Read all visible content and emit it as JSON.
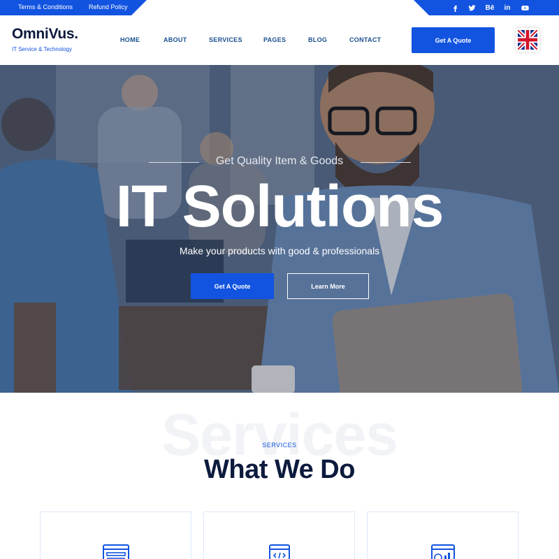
{
  "topbar": {
    "links": [
      "Terms & Conditions",
      "Refund Policy"
    ],
    "social": [
      {
        "icon": "facebook-icon",
        "glyph": "f"
      },
      {
        "icon": "twitter-icon",
        "glyph": "t"
      },
      {
        "icon": "behance-icon",
        "glyph": "Bē"
      },
      {
        "icon": "linkedin-icon",
        "glyph": "in"
      },
      {
        "icon": "youtube-icon",
        "glyph": "▶"
      }
    ]
  },
  "header": {
    "logo": "OmniVus.",
    "tagline": "IT Service & Technology",
    "nav": [
      "HOME",
      "ABOUT",
      "SERVICES",
      "PAGES",
      "BLOG",
      "CONTACT"
    ],
    "cta": "Get A Quote",
    "language_icon": "uk-flag-icon"
  },
  "hero": {
    "eyebrow": "Get Quality Item & Goods",
    "title": "IT Solutions",
    "subtitle": "Make your products with good & professionals",
    "primary_button": "Get A Quote",
    "secondary_button": "Learn More"
  },
  "services": {
    "background_word": "Services",
    "eyebrow": "SERVICES",
    "title": "What We Do",
    "cards": [
      {
        "icon": "browser-window-icon"
      },
      {
        "icon": "code-window-icon"
      },
      {
        "icon": "analytics-chart-icon"
      }
    ]
  },
  "colors": {
    "accent": "#1254e0",
    "heading": "#0c1a3d",
    "nav": "#1b4f8f"
  }
}
